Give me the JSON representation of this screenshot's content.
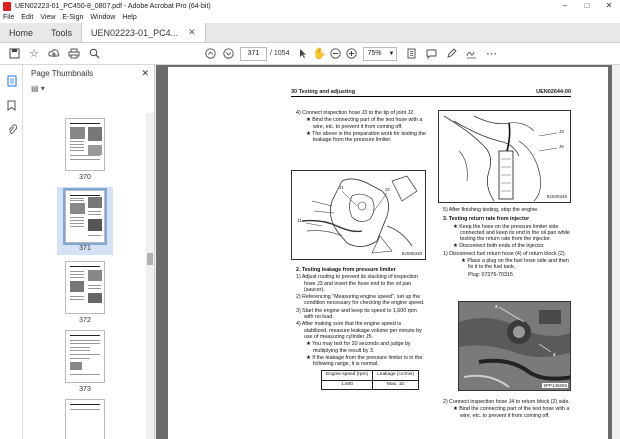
{
  "window": {
    "title": "UEN02223-01_PC450-8_0807.pdf - Adobe Acrobat Pro (64-bit)"
  },
  "menu": [
    "File",
    "Edit",
    "View",
    "E-Sign",
    "Window",
    "Help"
  ],
  "tabs": [
    {
      "label": "Home"
    },
    {
      "label": "Tools"
    },
    {
      "label": "UEN02223-01_PC4..."
    }
  ],
  "toolbar": {
    "page_current": "371",
    "page_total": "/ 1054",
    "zoom": "75%"
  },
  "panel": {
    "title": "Page Thumbnails",
    "thumbs": [
      "370",
      "371",
      "372",
      "373"
    ],
    "selected": "371"
  },
  "doc": {
    "header_left": "30 Testing and adjusting",
    "header_right": "UEN02644-00",
    "left_col": {
      "step4": "4)   Connect inspection hose J3 to the tip of joint J2.",
      "s4b1": "★  Bind the connecting part of the test hose with a wire, etc. to prevent it from coming off.",
      "s4b2": "★  The above is the preparation work for testing the leakage from the pressure limiter.",
      "fig1_code": "9JS05348",
      "fig1_j1a": "J1",
      "fig1_j2": "J2",
      "fig1_j1b": "J1",
      "sec2": "2.   Testing leakage from pressure limiter",
      "s1": "1)   Adjust routing to prevent its slacking of inspection hose J3 and insert the hose end to the oil pan (saucer).",
      "s2": "2)   Referencing \"Measuring engine speed\", set up the condition necessary for checking the engine speed.",
      "s3": "3)   Start the engine and keep its speed to 1,600 rpm with no load.",
      "s4": "4)   After making sure that the engine speed is stabilized, measure leakage volume per minute by use of measuring cylinder J5.",
      "s4n1": "★  You may test for 20 seconds and judge by multiplying the result by 3.",
      "s4n2": "★  If the leakage from the pressure limiter is in the following range, it is normal.",
      "table_h1": "Engine speed (rpm)",
      "table_h2": "Leakage (cc/min)",
      "table_v1": "1,600",
      "table_v2": "Max. 10"
    },
    "right_col": {
      "fig2_j3": "J3",
      "fig2_j5": "J5",
      "fig2_code": "9JS05349",
      "s5": "5)   After finishing testing, stop the engine.",
      "sec3": "3.   Testing return rate from injector",
      "r1": "★  Keep the hose on the pressure limiter side connected and keep its end in the oil pan while testing the return rate from the injector.",
      "r2": "★  Disconnect both ends of the injector.",
      "r3": "1)   Disconnect fuel return hose (4) of return block (2).",
      "r3n": "★  Place a plug on the fuel hose side and then fix it to the fuel tank.",
      "r3p": "Plug: 07376-70315",
      "fig3_2": "2",
      "fig3_4": "4",
      "fig3_code": "9PP145656",
      "r4": "2)   Connect inspection hose J4 to return block (2) side.",
      "r4n": "★  Bind the connecting part of the test hose with a wire, etc. to prevent it from coming off."
    }
  },
  "colors": {
    "accent": "#1a73e8",
    "viewer_bg": "#6b6b6b",
    "selection": "#d4e2f4",
    "acrobat_red": "#e02020"
  }
}
